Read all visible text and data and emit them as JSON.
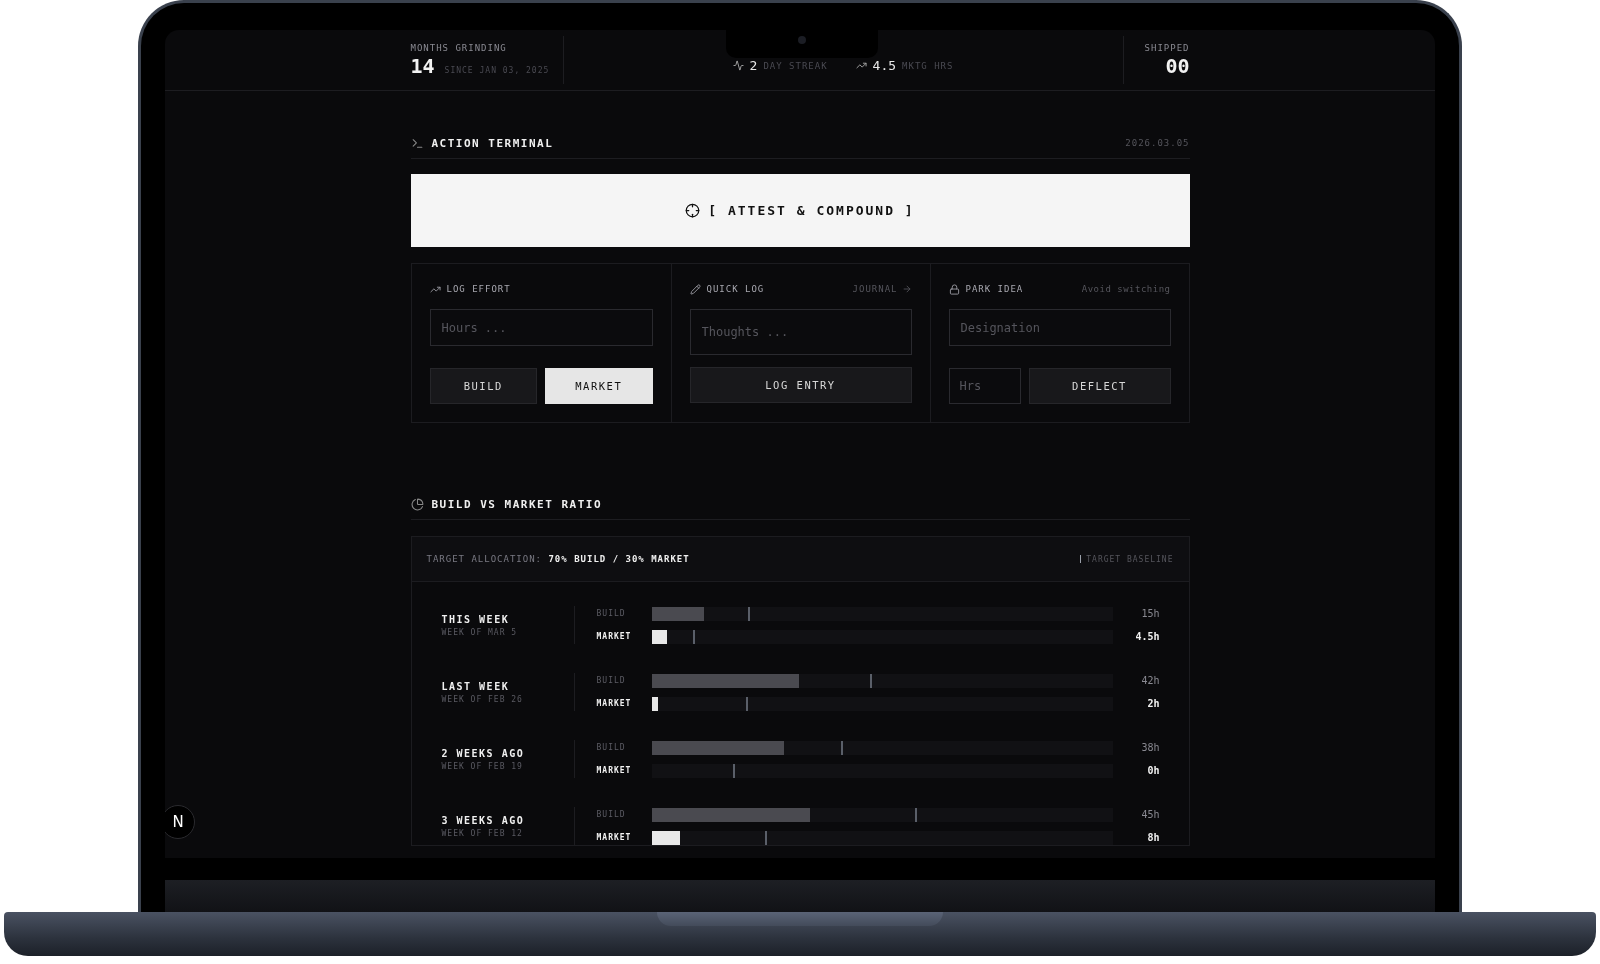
{
  "header": {
    "months": {
      "label": "MONTHS GRINDING",
      "value": "14",
      "since": "SINCE JAN 03, 2025"
    },
    "stats": [
      {
        "kind": "streak",
        "value": "2",
        "label": "DAY STREAK"
      },
      {
        "kind": "trend",
        "value": "4.5",
        "label": "MKTG HRS"
      }
    ],
    "shipped": {
      "label": "SHIPPED",
      "value": "00"
    }
  },
  "terminal": {
    "title": "ACTION TERMINAL",
    "date": "2026.03.05",
    "attest_button": "[ ATTEST & COMPOUND ]",
    "cards": [
      {
        "kind": "effort",
        "title": "LOG EFFORT",
        "input": {
          "placeholder": "Hours ..."
        },
        "options": [
          {
            "label": "BUILD",
            "selected": false
          },
          {
            "label": "MARKET",
            "selected": true
          }
        ]
      },
      {
        "kind": "quick",
        "title": "QUICK LOG",
        "link": "JOURNAL",
        "input": {
          "placeholder": "Thoughts ..."
        },
        "button": "LOG ENTRY"
      },
      {
        "kind": "park",
        "title": "PARK IDEA",
        "note": "Avoid switching",
        "input": {
          "placeholder": "Designation"
        },
        "hours": {
          "placeholder": "Hrs"
        },
        "button": "DEFLECT"
      }
    ]
  },
  "ratio": {
    "title": "BUILD VS MARKET RATIO",
    "allocation": "TARGET ALLOCATION: **70% BUILD / 30% MARKET**",
    "legend": "TARGET BASELINE",
    "weeks": [
      {
        "name": "THIS WEEK",
        "sub": "WEEK OF MAR 5",
        "bars": [
          {
            "kind": "build",
            "label": "BUILD",
            "value": "15h",
            "level": 0.113,
            "target": {
              "level": 0.21
            }
          },
          {
            "kind": "market",
            "label": "MARKET",
            "value": "4.5h",
            "level": 0.033,
            "target": {
              "level": 0.09
            }
          }
        ]
      },
      {
        "name": "LAST WEEK",
        "sub": "WEEK OF FEB 26",
        "bars": [
          {
            "kind": "build",
            "label": "BUILD",
            "value": "42h",
            "level": 0.32,
            "target": {
              "level": 0.473
            }
          },
          {
            "kind": "market",
            "label": "MARKET",
            "value": "2h",
            "level": 0.015,
            "target": {
              "level": 0.206
            }
          }
        ]
      },
      {
        "name": "2 WEEKS AGO",
        "sub": "WEEK OF FEB 19",
        "bars": [
          {
            "kind": "build",
            "label": "BUILD",
            "value": "38h",
            "level": 0.288,
            "target": {
              "level": 0.41
            }
          },
          {
            "kind": "market",
            "label": "MARKET",
            "value": "0h",
            "level": 0,
            "target": {
              "level": 0.177
            }
          }
        ]
      },
      {
        "name": "3 WEEKS AGO",
        "sub": "WEEK OF FEB 12",
        "bars": [
          {
            "kind": "build",
            "label": "BUILD",
            "value": "45h",
            "level": 0.343,
            "target": {
              "level": 0.571
            }
          },
          {
            "kind": "market",
            "label": "MARKET",
            "value": "8h",
            "level": 0.062,
            "target": {
              "level": 0.246
            }
          }
        ]
      }
    ]
  },
  "dev_badge": "N"
}
